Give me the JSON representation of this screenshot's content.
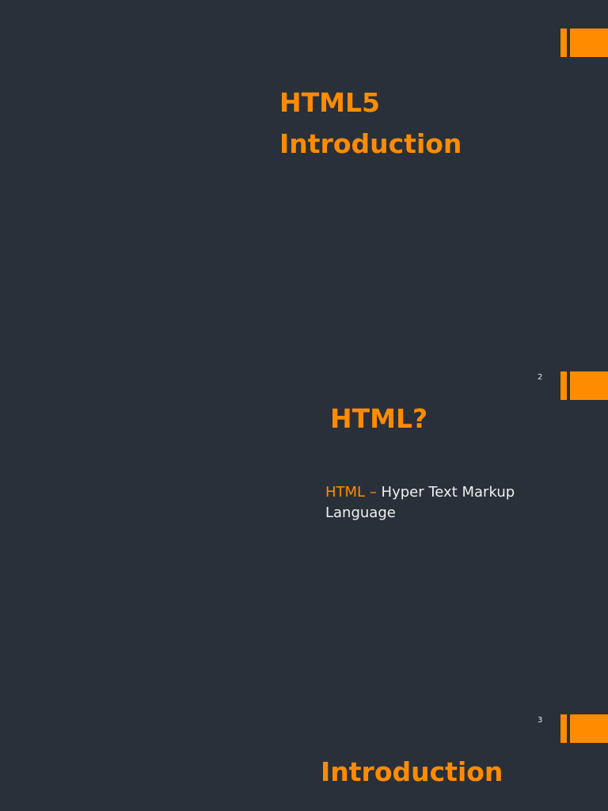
{
  "colors": {
    "background": "#293039",
    "accent": "#ff8c00"
  },
  "slides": [
    {
      "title_line1": "HTML5",
      "title_line2": "Introduction"
    },
    {
      "page_number": "2",
      "title": "HTML?",
      "body_term": "HTML",
      "body_dash": " – ",
      "body_text": "Hyper Text Markup Language"
    },
    {
      "page_number": "3",
      "title": "Introduction"
    }
  ]
}
